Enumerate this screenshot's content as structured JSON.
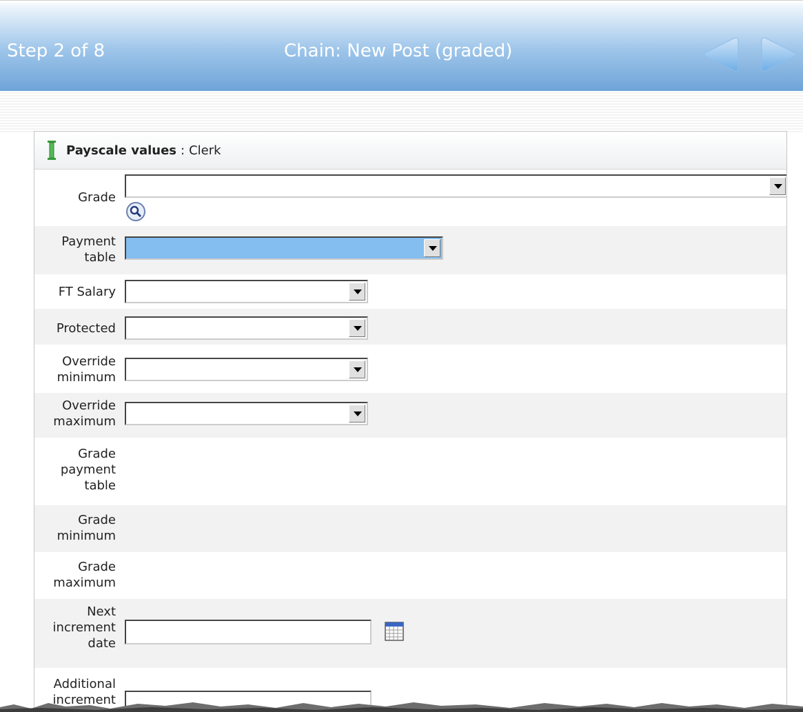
{
  "header": {
    "step": "Step 2 of 8",
    "title": "Chain: New Post (graded)"
  },
  "panel": {
    "title": "Payscale values",
    "separator": ":",
    "subject": "Clerk"
  },
  "fields": {
    "grade": {
      "label": "Grade",
      "value": ""
    },
    "payment_table": {
      "label_1": "Payment",
      "label_2": "table",
      "value": ""
    },
    "ft_salary": {
      "label": "FT Salary",
      "value": ""
    },
    "protected": {
      "label": "Protected",
      "value": ""
    },
    "override_minimum": {
      "label_1": "Override",
      "label_2": "minimum",
      "value": ""
    },
    "override_maximum": {
      "label_1": "Override",
      "label_2": "maximum",
      "value": ""
    },
    "grade_payment_table": {
      "label_1": "Grade",
      "label_2": "payment",
      "label_3": "table"
    },
    "grade_minimum": {
      "label_1": "Grade",
      "label_2": "minimum"
    },
    "grade_maximum": {
      "label_1": "Grade",
      "label_2": "maximum"
    },
    "next_increment_date": {
      "label_1": "Next",
      "label_2": "increment",
      "label_3": "date",
      "value": ""
    },
    "additional_increment": {
      "label_1": "Additional",
      "label_2": "increment",
      "value": ""
    }
  },
  "colors": {
    "header_gradient_bottom": "#6ea3d8",
    "selected_field": "#84bdf0",
    "nav_arrow": "#7fb6ea"
  },
  "icons": {
    "prev": "left-arrow-icon",
    "next": "right-arrow-icon",
    "panel": "bar-icon",
    "lookup": "magnifier-icon",
    "calendar": "calendar-icon",
    "dropdown": "chevron-down-icon"
  }
}
